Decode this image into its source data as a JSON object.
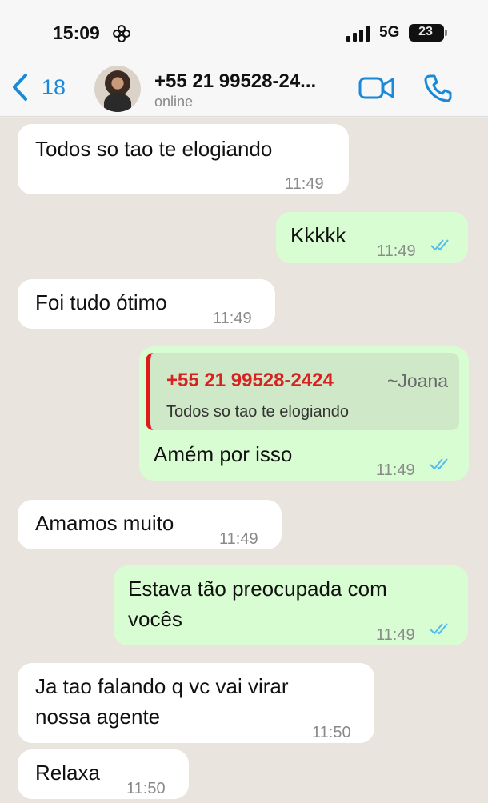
{
  "status_bar": {
    "time": "15:09",
    "network": "5G",
    "battery": "23",
    "battery_level": 0.23,
    "icons": [
      "flower-icon",
      "signal-icon"
    ]
  },
  "header": {
    "back_count": "18",
    "contact_name": "+55 21 99528-24...",
    "contact_status": "online",
    "icons": [
      "back-chevron-icon",
      "video-call-icon",
      "phone-call-icon"
    ]
  },
  "messages": [
    {
      "direction": "in",
      "text": "Todos so tao te elogiando",
      "time": "11:49"
    },
    {
      "direction": "out",
      "text": "Kkkkk",
      "time": "11:49",
      "read": true
    },
    {
      "direction": "in",
      "text": "Foi tudo ótimo",
      "time": "11:49"
    },
    {
      "direction": "out",
      "quote": {
        "name": "+55 21 99528-2424",
        "alias": "~Joana",
        "text": "Todos so tao te elogiando"
      },
      "text": "Amém por isso",
      "time": "11:49",
      "read": true
    },
    {
      "direction": "in",
      "text": "Amamos muito",
      "time": "11:49"
    },
    {
      "direction": "out",
      "text": "Estava tão preocupada com vocês",
      "lines": [
        "Estava tão preocupada com",
        "vocês"
      ],
      "time": "11:49",
      "read": true
    },
    {
      "direction": "in",
      "text": "Ja tao falando q vc vai virar nossa agente",
      "lines": [
        "Ja tao falando q vc vai virar",
        "nossa agente"
      ],
      "time": "11:50"
    },
    {
      "direction": "in",
      "text": "Relaxa",
      "time": "11:50"
    }
  ],
  "colors": {
    "accent": "#1a8ad8",
    "incoming_bubble": "#ffffff",
    "outgoing_bubble": "#d9fdd3",
    "chat_background": "#e9e4dd",
    "quote_bar": "#e11b1b",
    "read_ticks": "#53bdeb"
  }
}
